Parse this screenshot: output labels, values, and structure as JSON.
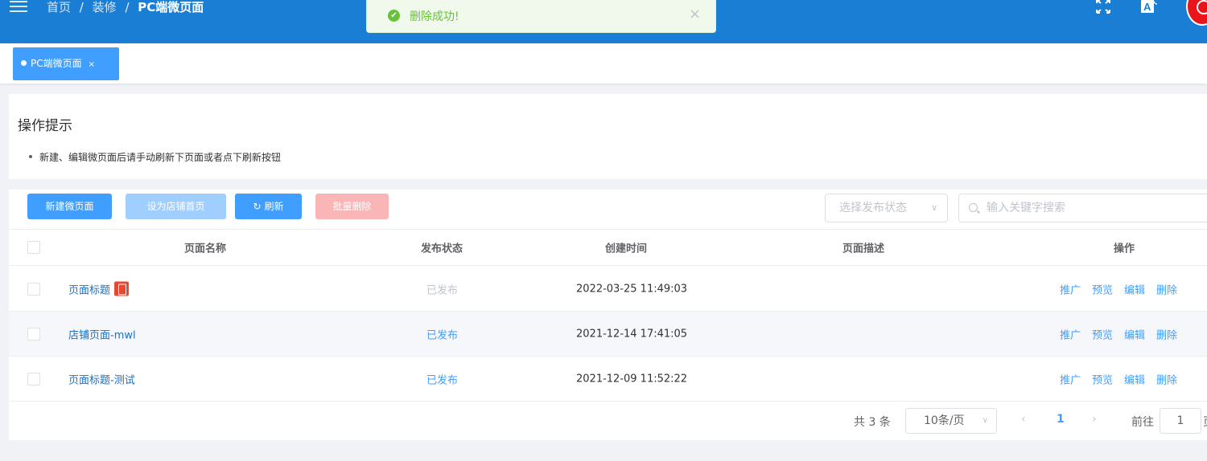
{
  "header": {
    "breadcrumb": [
      "首页",
      "装修",
      "PC端微页面"
    ],
    "separator": "/",
    "icons": [
      "menu-icon",
      "fullscreen-icon",
      "translate-icon",
      "avatar"
    ],
    "translate_glyph": "A",
    "colors": {
      "bar": "#1a7fd4"
    }
  },
  "toast": {
    "message": "删除成功!",
    "check_glyph": "✔",
    "close_glyph": "×"
  },
  "tabs": [
    {
      "label": "PC端微页面",
      "close": "×",
      "active": true
    }
  ],
  "tips": {
    "title": "操作提示",
    "items": [
      "新建、编辑微页面后请手动刷新下页面或者点下刷新按钮"
    ]
  },
  "toolbar": {
    "new_label": "新建微页面",
    "home_label": "设为店铺首页",
    "refresh_label": "刷新",
    "refresh_glyph": "↻",
    "batch_delete_label": "批量删除",
    "status_placeholder": "选择发布状态",
    "chevron": "∨",
    "search_placeholder": "输入关键字搜索"
  },
  "table": {
    "columns": [
      "页面名称",
      "发布状态",
      "创建时间",
      "页面描述",
      "操作"
    ],
    "rows": [
      {
        "name": "页面标题",
        "has_badge": true,
        "status": "已发布",
        "status_style": "gray",
        "created": "2022-03-25 11:49:03",
        "desc": "",
        "actions": [
          "推广",
          "预览",
          "编辑",
          "删除"
        ]
      },
      {
        "name": "店铺页面-mwl",
        "has_badge": false,
        "status": "已发布",
        "status_style": "blue",
        "created": "2021-12-14 17:41:05",
        "desc": "",
        "actions": [
          "推广",
          "预览",
          "编辑",
          "删除"
        ]
      },
      {
        "name": "页面标题-测试",
        "has_badge": false,
        "status": "已发布",
        "status_style": "blue",
        "created": "2021-12-09 11:52:22",
        "desc": "",
        "actions": [
          "推广",
          "预览",
          "编辑",
          "删除"
        ]
      }
    ]
  },
  "pagination": {
    "total": "共 3 条",
    "page_size": "10条/页",
    "chevron": "∨",
    "prev": "‹",
    "current": "1",
    "next": "›",
    "goto_label": "前往",
    "goto_value": "1",
    "goto_suffix": "页"
  }
}
